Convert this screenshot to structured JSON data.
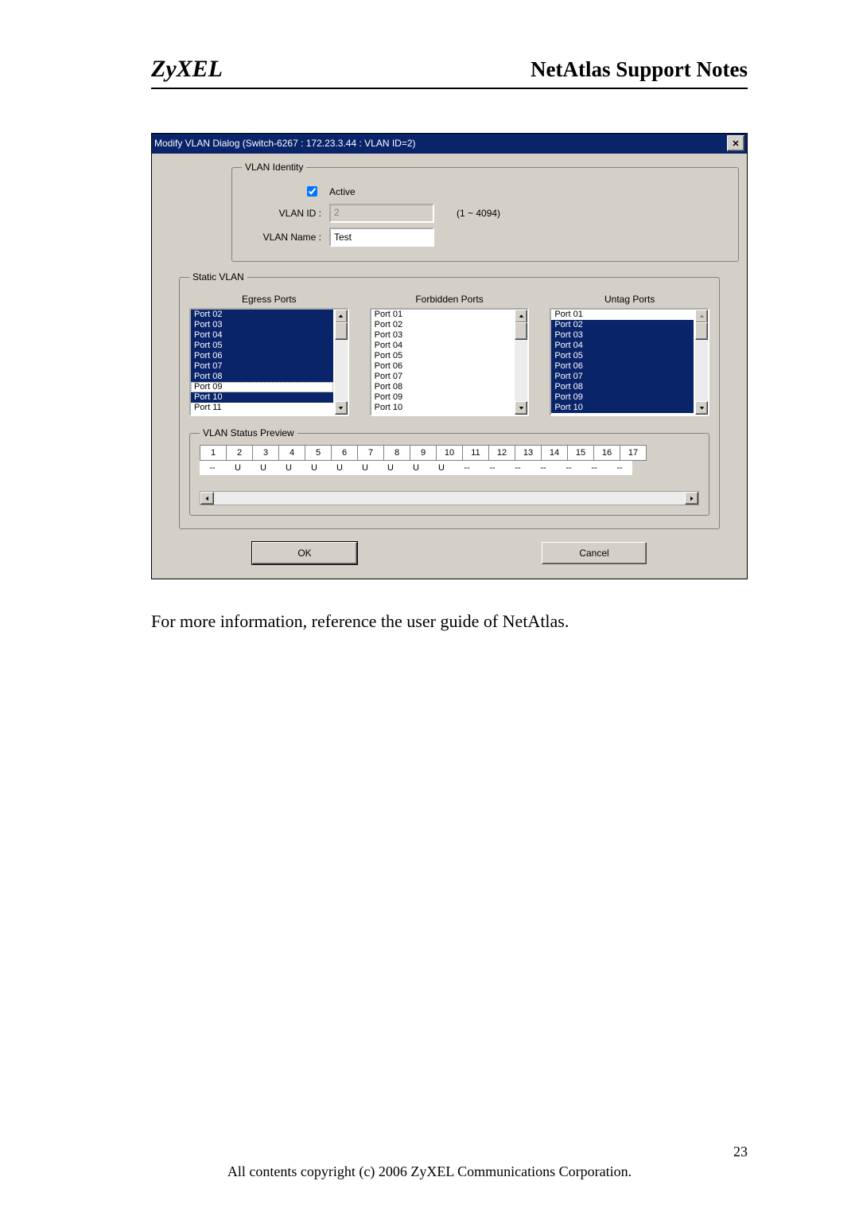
{
  "header": {
    "brand": "ZyXEL",
    "title": "NetAtlas Support Notes"
  },
  "dialog": {
    "title": "Modify VLAN Dialog (Switch-6267 : 172.23.3.44 : VLAN ID=2)",
    "close_label": "✕",
    "identity": {
      "legend": "VLAN Identity",
      "active_label": "Active",
      "active_checked": true,
      "vlan_id_label": "VLAN ID :",
      "vlan_id_value": "2",
      "vlan_id_range": "(1 ~ 4094)",
      "vlan_name_label": "VLAN Name :",
      "vlan_name_value": "Test"
    },
    "static": {
      "legend": "Static VLAN",
      "egress": {
        "header": "Egress Ports",
        "items": [
          "Port 02",
          "Port 03",
          "Port 04",
          "Port 05",
          "Port 06",
          "Port 07",
          "Port 08",
          "Port 09",
          "Port 10",
          "Port 11"
        ],
        "selected": [
          "Port 02",
          "Port 03",
          "Port 04",
          "Port 05",
          "Port 06",
          "Port 07",
          "Port 08",
          "Port 10"
        ],
        "focus": "Port 09"
      },
      "forbidden": {
        "header": "Forbidden Ports",
        "items": [
          "Port 01",
          "Port 02",
          "Port 03",
          "Port 04",
          "Port 05",
          "Port 06",
          "Port 07",
          "Port 08",
          "Port 09",
          "Port 10"
        ],
        "selected": []
      },
      "untag": {
        "header": "Untag Ports",
        "items": [
          "Port 01",
          "Port 02",
          "Port 03",
          "Port 04",
          "Port 05",
          "Port 06",
          "Port 07",
          "Port 08",
          "Port 09",
          "Port 10"
        ],
        "selected": [
          "Port 02",
          "Port 03",
          "Port 04",
          "Port 05",
          "Port 06",
          "Port 07",
          "Port 08",
          "Port 09",
          "Port 10"
        ]
      }
    },
    "preview": {
      "legend": "VLAN Status Preview",
      "ports": [
        "1",
        "2",
        "3",
        "4",
        "5",
        "6",
        "7",
        "8",
        "9",
        "10",
        "11",
        "12",
        "13",
        "14",
        "15",
        "16",
        "17"
      ],
      "status": [
        "--",
        "U",
        "U",
        "U",
        "U",
        "U",
        "U",
        "U",
        "U",
        "U",
        "--",
        "--",
        "--",
        "--",
        "--",
        "--",
        "--"
      ]
    },
    "buttons": {
      "ok": "OK",
      "cancel": "Cancel"
    }
  },
  "caption": "For more information, reference the user guide of NetAtlas.",
  "page_number": "23",
  "copyright": "All contents copyright (c) 2006 ZyXEL Communications Corporation."
}
